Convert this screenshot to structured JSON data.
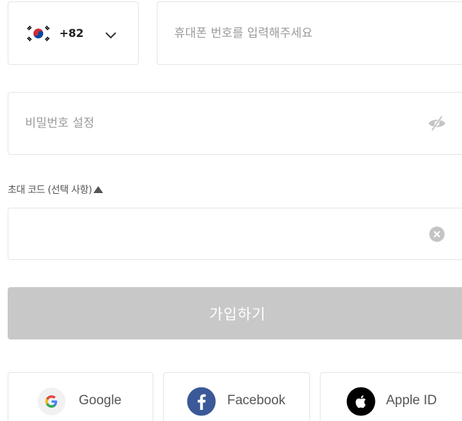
{
  "country": {
    "flag_icon": "korea-flag-icon",
    "code": "+82",
    "dropdown_icon": "chevron-down-icon"
  },
  "phone": {
    "placeholder": "휴대폰 번호를 입력해주세요",
    "value": ""
  },
  "password": {
    "placeholder": "비밀번호 설정",
    "value": "",
    "toggle_icon": "eye-off-icon"
  },
  "invite": {
    "label": "초대 코드 (선택 사항)",
    "toggle_icon": "triangle-up-icon",
    "value": "",
    "clear_icon": "clear-circle-icon"
  },
  "submit": {
    "label": "가입하기",
    "color": "#c8c8c8"
  },
  "social": [
    {
      "label": "Google",
      "icon": "google-icon"
    },
    {
      "label": "Facebook",
      "icon": "facebook-icon",
      "color": "#3b5998"
    },
    {
      "label": "Apple ID",
      "icon": "apple-icon",
      "color": "#000000"
    }
  ]
}
